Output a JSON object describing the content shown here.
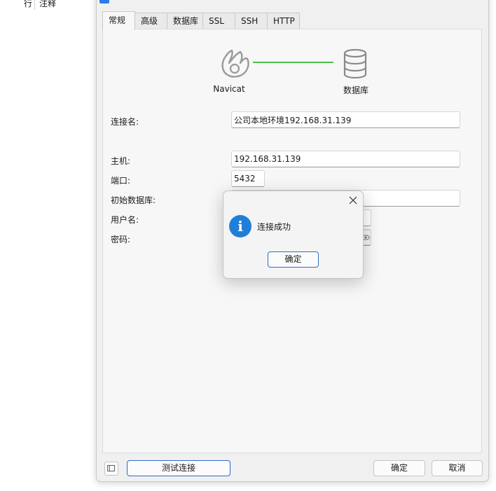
{
  "background": {
    "col1": "行",
    "col2": "注释"
  },
  "tabs": [
    "常规",
    "高级",
    "数据库",
    "SSL",
    "SSH",
    "HTTP"
  ],
  "graphic": {
    "left_caption": "Navicat",
    "right_caption": "数据库",
    "line_color": "#4cc04a"
  },
  "form": {
    "connection_name": {
      "label": "连接名:",
      "value": "公司本地环境192.168.31.139"
    },
    "host": {
      "label": "主机:",
      "value": "192.168.31.139"
    },
    "port": {
      "label": "端口:",
      "value": "5432"
    },
    "initial_db": {
      "label": "初始数据库:",
      "value": ""
    },
    "username": {
      "label": "用户名:",
      "value": ""
    },
    "password": {
      "label": "密码:",
      "value": ""
    }
  },
  "buttons": {
    "test": "测试连接",
    "ok": "确定",
    "cancel": "取消"
  },
  "popup": {
    "message": "连接成功",
    "ok": "确定",
    "icon": "info-icon",
    "icon_glyph": "i",
    "icon_color": "#1f7fd8"
  }
}
